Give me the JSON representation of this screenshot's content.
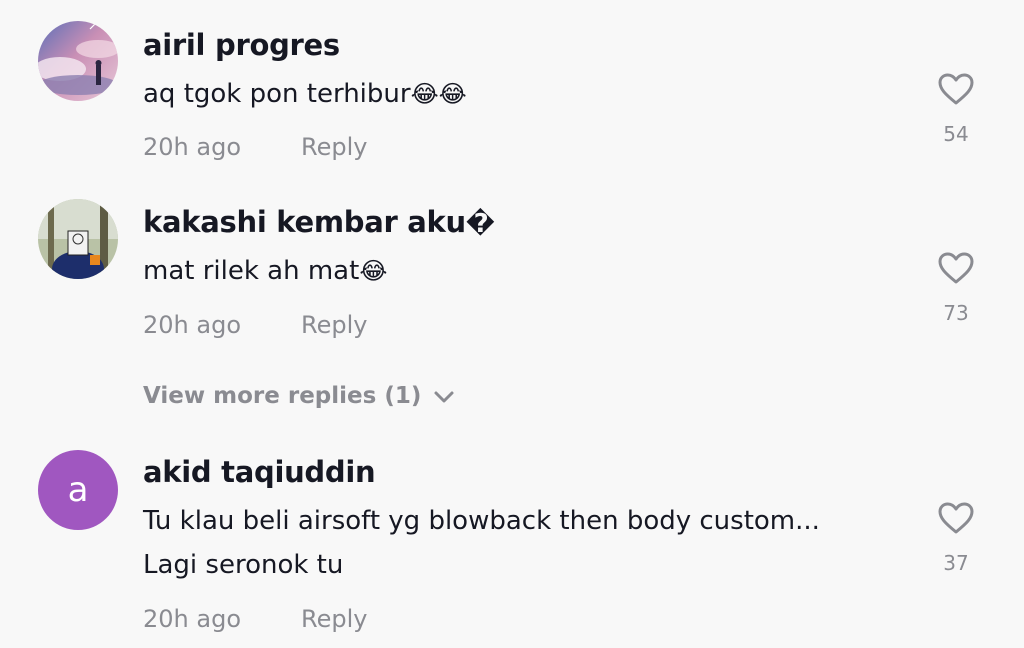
{
  "comments": [
    {
      "username": "airil progres",
      "text": "aq tgok pon terhibur",
      "emoji": "😂😂",
      "time": "20h ago",
      "reply_label": "Reply",
      "likes": "54"
    },
    {
      "username": "kakashi kembar aku",
      "username_suffix": "�",
      "text": "mat rilek ah mat",
      "emoji": "😂",
      "time": "20h ago",
      "reply_label": "Reply",
      "likes": "73"
    },
    {
      "avatar_letter": "a",
      "avatar_color": "#a057c0",
      "username": "akid taqiuddin",
      "text_line1": "Tu klau beli airsoft yg blowback then body custom...",
      "text_line2": "Lagi seronok tu",
      "time": "20h ago",
      "reply_label": "Reply",
      "likes": "37"
    }
  ],
  "view_more": {
    "label": "View more replies (1)",
    "icon": "chevron-down-icon"
  },
  "icons": {
    "like": "heart-outline-icon"
  },
  "colors": {
    "background": "#f8f8f8",
    "primary_text": "#161823",
    "secondary_text": "#8a8b91",
    "avatar_purple": "#a057c0"
  }
}
